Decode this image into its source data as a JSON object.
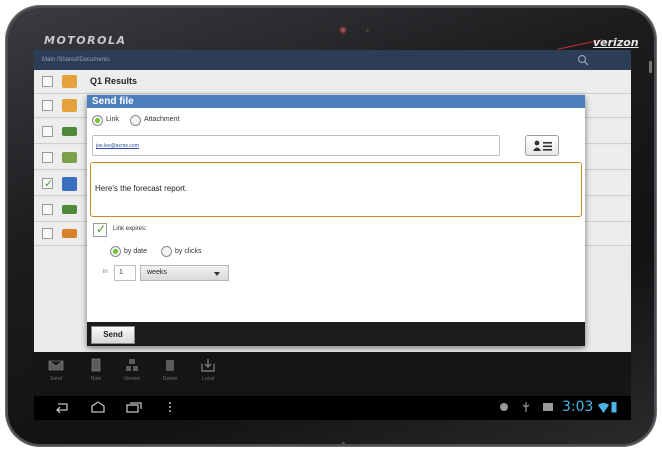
{
  "device": {
    "brand": "MOTOROLA",
    "carrier": "verizon"
  },
  "screen": {
    "path": "Main /Shared/Documents",
    "files": [
      {
        "name": "Q1 Results",
        "icon": "folder-icon",
        "checked": false
      },
      {
        "name": "",
        "icon": "folder-icon",
        "checked": false
      },
      {
        "name": "",
        "icon": "spreadsheet-icon",
        "checked": false
      },
      {
        "name": "",
        "icon": "image-icon",
        "checked": false
      },
      {
        "name": "",
        "icon": "word-doc-icon",
        "checked": true
      },
      {
        "name": "",
        "icon": "spreadsheet-icon",
        "checked": false
      },
      {
        "name": "",
        "icon": "presentation-icon",
        "checked": false
      }
    ],
    "actions": [
      {
        "label": "Send",
        "icon": "send-icon"
      },
      {
        "label": "Note",
        "icon": "note-icon"
      },
      {
        "label": "Version",
        "icon": "version-icon"
      },
      {
        "label": "Delete",
        "icon": "delete-icon"
      },
      {
        "label": "Local",
        "icon": "local-icon"
      }
    ]
  },
  "dialog": {
    "title": "Send file",
    "option_link": "Link",
    "option_attachment": "Attachment",
    "email": "joe.lee@acme.com",
    "message": "Here's the forecast report.",
    "link_expires": "Link expires:",
    "by_date": "by date",
    "by_clicks": "by clicks",
    "in_label": "in",
    "amount": "1",
    "unit": "weeks",
    "send": "Send"
  },
  "status": {
    "time": "3:03"
  },
  "colors": {
    "dialog_title": "#4d7fbd",
    "radio_on": "#6cc32a",
    "message_border": "#cc8a25",
    "clock": "#49b5e6"
  }
}
